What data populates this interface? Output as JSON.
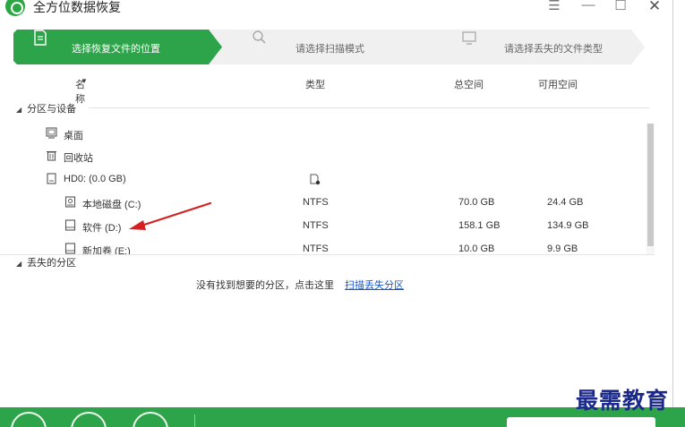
{
  "app": {
    "title": "全方位数据恢复"
  },
  "window_controls": {
    "menu": "☰",
    "minimize": "—",
    "maximize": "☐",
    "close": "✕"
  },
  "steps": [
    {
      "label": "选择恢复文件的位置",
      "icon": "document-icon",
      "active": true
    },
    {
      "label": "请选择扫描模式",
      "icon": "search-icon",
      "active": false
    },
    {
      "label": "请选择丢失的文件类型",
      "icon": "monitor-icon",
      "active": false
    }
  ],
  "columns": {
    "name": "名称",
    "sort": "▼",
    "type": "类型",
    "total": "总空间",
    "free": "可用空间"
  },
  "sections": {
    "partitions": "分区与设备",
    "lost": "丢失的分区",
    "expanded_marker": "◢"
  },
  "tree": {
    "desktop": {
      "name": "桌面",
      "icon": "desktop-icon"
    },
    "recycle": {
      "name": "回收站",
      "icon": "trash-icon"
    },
    "disk": {
      "name": "HD0:  (0.0 GB)",
      "icon": "disk-icon",
      "type_icon": "file-settings-icon"
    },
    "partitions": [
      {
        "name": "本地磁盘 (C:)",
        "type": "NTFS",
        "total": "70.0 GB",
        "free": "24.4 GB",
        "icon": "drive-c-icon"
      },
      {
        "name": "软件 (D:)",
        "type": "NTFS",
        "total": "158.1 GB",
        "free": "134.9 GB",
        "icon": "drive-icon"
      },
      {
        "name": "新加卷 (E:)",
        "type": "NTFS",
        "total": "10.0 GB",
        "free": "9.9 GB",
        "icon": "drive-icon"
      }
    ]
  },
  "hint": {
    "text": "没有找到想要的分区，点击这里",
    "link": "扫描丢失分区"
  },
  "watermark": "最需教育",
  "colors": {
    "accent": "#2da44a",
    "step_inactive": "#f0f0f0",
    "link": "#1a57c9",
    "arrow": "#d42020",
    "watermark": "#1b2a8a"
  }
}
